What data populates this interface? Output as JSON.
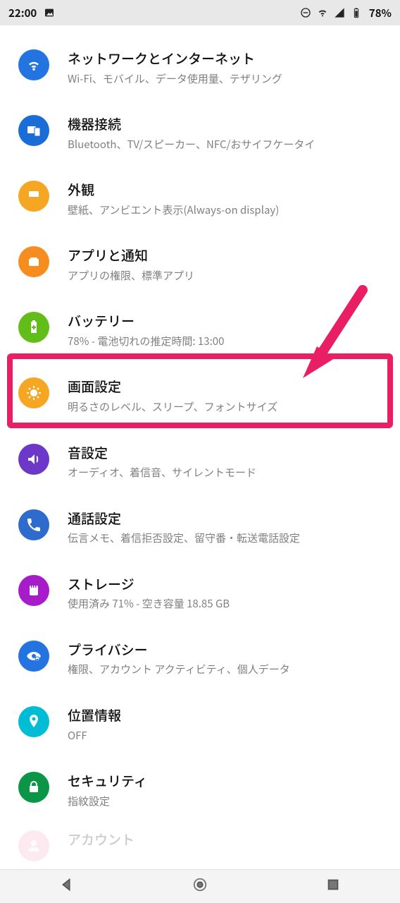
{
  "status": {
    "time": "22:00",
    "battery": "78%"
  },
  "highlight_arrow_target": "display",
  "items": [
    {
      "id": "network",
      "title": "ネットワークとインターネット",
      "subtitle": "Wi-Fi、モバイル、データ使用量、テザリング"
    },
    {
      "id": "devices",
      "title": "機器接続",
      "subtitle": "Bluetooth、TV/スピーカー、NFC/おサイフケータイ"
    },
    {
      "id": "appearance",
      "title": "外観",
      "subtitle": "壁紙、アンビエント表示(Always-on display)"
    },
    {
      "id": "apps",
      "title": "アプリと通知",
      "subtitle": "アプリの権限、標準アプリ"
    },
    {
      "id": "battery",
      "title": "バッテリー",
      "subtitle": "78% - 電池切れの推定時間: 13:00"
    },
    {
      "id": "display",
      "title": "画面設定",
      "subtitle": "明るさのレベル、スリープ、フォントサイズ"
    },
    {
      "id": "sound",
      "title": "音設定",
      "subtitle": "オーディオ、着信音、サイレントモード"
    },
    {
      "id": "call",
      "title": "通話設定",
      "subtitle": "伝言メモ、着信拒否設定、留守番・転送電話設定"
    },
    {
      "id": "storage",
      "title": "ストレージ",
      "subtitle": "使用済み 71% - 空き容量 18.85 GB"
    },
    {
      "id": "privacy",
      "title": "プライバシー",
      "subtitle": "権限、アカウント アクティビティ、個人データ"
    },
    {
      "id": "location",
      "title": "位置情報",
      "subtitle": "OFF"
    },
    {
      "id": "security",
      "title": "セキュリティ",
      "subtitle": "指紋設定"
    },
    {
      "id": "account",
      "title": "アカウント",
      "subtitle": ""
    }
  ]
}
